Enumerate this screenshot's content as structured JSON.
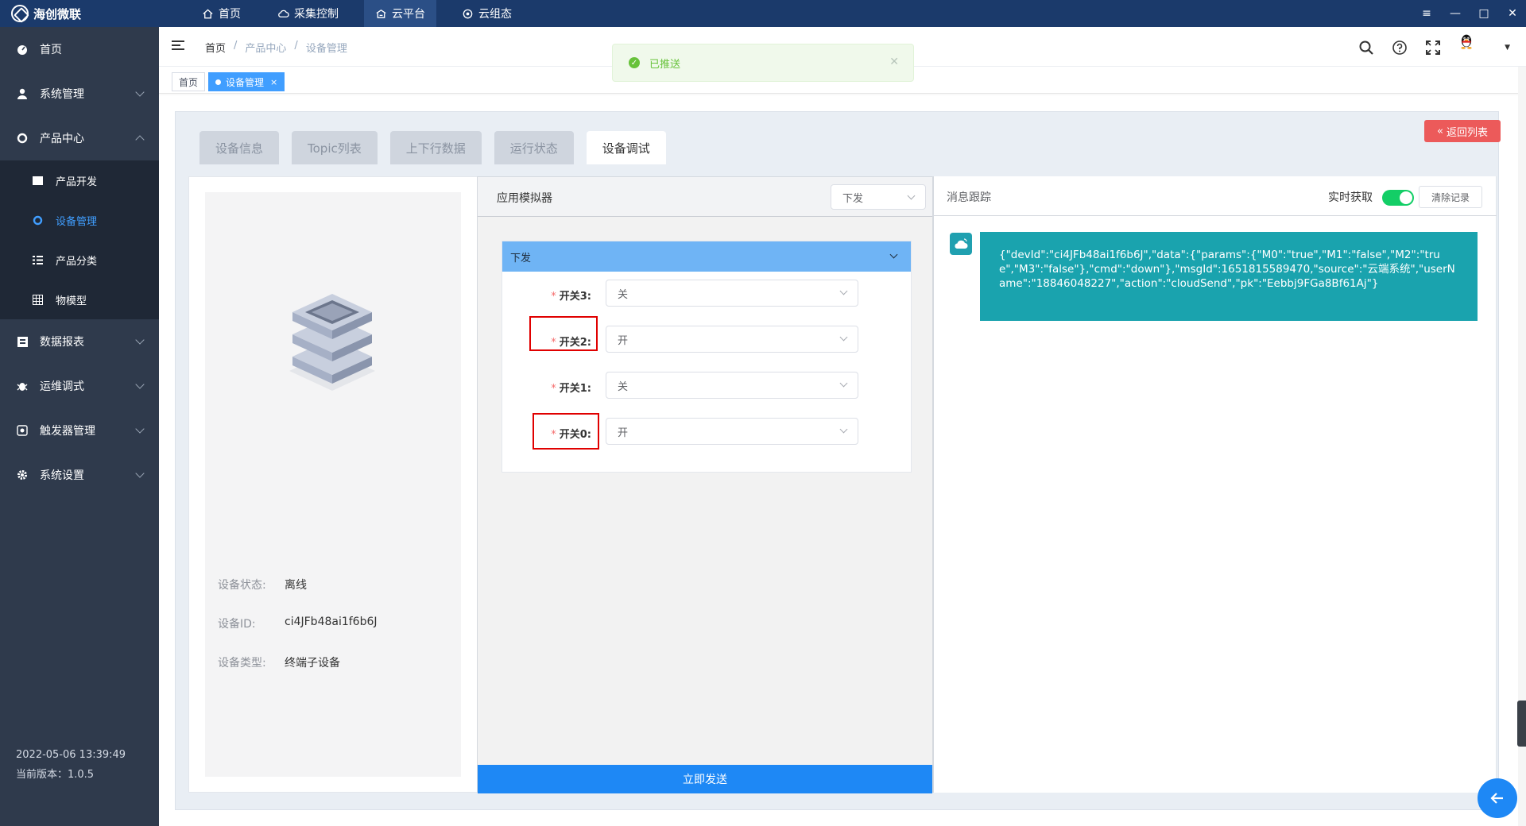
{
  "app": {
    "logo_text": "海创微联"
  },
  "topnav": [
    {
      "label": "首页",
      "icon": "home-icon"
    },
    {
      "label": "采集控制",
      "icon": "cloud-control-icon"
    },
    {
      "label": "云平台",
      "icon": "cloud-platform-icon"
    },
    {
      "label": "云组态",
      "icon": "cloud-config-icon"
    }
  ],
  "window_controls": {
    "menu": "≡",
    "minimize": "—",
    "maximize": "□",
    "close": "✕"
  },
  "sidebar": {
    "items": [
      {
        "label": "首页",
        "icon": "dashboard-icon"
      },
      {
        "label": "系统管理",
        "icon": "user-icon"
      },
      {
        "label": "产品中心",
        "icon": "product-icon"
      },
      {
        "label": "数据报表",
        "icon": "report-icon"
      },
      {
        "label": "运维调式",
        "icon": "bug-icon"
      },
      {
        "label": "触发器管理",
        "icon": "trigger-icon"
      },
      {
        "label": "系统设置",
        "icon": "gear-icon"
      }
    ],
    "sub_items": [
      {
        "label": "产品开发",
        "icon": "folder-icon"
      },
      {
        "label": "设备管理",
        "icon": "device-icon"
      },
      {
        "label": "产品分类",
        "icon": "list-icon"
      },
      {
        "label": "物模型",
        "icon": "table-icon"
      }
    ],
    "footer": {
      "datetime": "2022-05-06 13:39:49",
      "version": "当前版本：1.0.5"
    }
  },
  "breadcrumb": [
    "首页",
    "/",
    "产品中心",
    "/",
    "设备管理"
  ],
  "tags": {
    "home": "首页",
    "active": "设备管理",
    "close": "×"
  },
  "toast": {
    "text": "已推送",
    "close": "✕"
  },
  "tabs": [
    "设备信息",
    "Topic列表",
    "上下行数据",
    "运行状态",
    "设备调试"
  ],
  "back_button": "返回列表",
  "device": {
    "status_label": "设备状态:",
    "status_value": "离线",
    "id_label": "设备ID:",
    "id_value": "ci4JFb48ai1f6b6J",
    "type_label": "设备类型:",
    "type_value": "终端子设备"
  },
  "simulator": {
    "title": "应用模拟器",
    "direction_select": "下发",
    "collapse_title": "下发",
    "fields": [
      {
        "label": "开关3:",
        "value": "关"
      },
      {
        "label": "开关2:",
        "value": "开"
      },
      {
        "label": "开关1:",
        "value": "关"
      },
      {
        "label": "开关0:",
        "value": "开"
      }
    ],
    "required_mark": "*",
    "send_button": "立即发送"
  },
  "trace": {
    "title": "消息跟踪",
    "realtime_label": "实时获取",
    "realtime_on": true,
    "clear_button": "清除记录",
    "messages": [
      "{\"devId\":\"ci4JFb48ai1f6b6J\",\"data\":{\"params\":{\"M0\":\"true\",\"M1\":\"false\",\"M2\":\"true\",\"M3\":\"false\"},\"cmd\":\"down\"},\"msgId\":1651815589470,\"source\":\"云端系统\",\"userName\":\"18846048227\",\"action\":\"cloudSend\",\"pk\":\"Eebbj9FGa8Bf61Aj\"}"
    ]
  },
  "colors": {
    "topbar": "#1b3a6b",
    "sidebar": "#2f3a4c",
    "accent": "#409eff",
    "message": "#1aa3ae",
    "danger": "#ec5a5a",
    "success": "#67c23a"
  }
}
